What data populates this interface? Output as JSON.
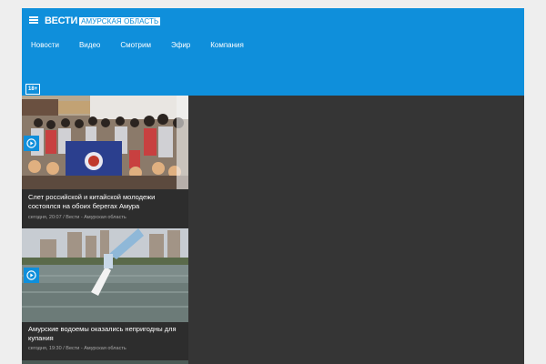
{
  "header": {
    "logo_main": "ВЕСТИ",
    "logo_region": "АМУРСКАЯ ОБЛАСТЬ",
    "menu_icon": "hamburger-menu-icon",
    "nav": [
      {
        "label": "Новости"
      },
      {
        "label": "Видео"
      },
      {
        "label": "Смотрим"
      },
      {
        "label": "Эфир"
      },
      {
        "label": "Компания"
      }
    ],
    "age_rating": "18+"
  },
  "news": [
    {
      "title": "Слет российской и китайской молодежи состоялся на обоих берегах Амура",
      "time": "сегодня, 20:07",
      "source": "Вести - Амурская область",
      "media_icon": "play-video-icon"
    },
    {
      "title": "Амурские водоемы оказались непригодны для купания",
      "time": "сегодня, 19:30",
      "source": "Вести - Амурская область",
      "media_icon": "play-video-icon"
    }
  ],
  "colors": {
    "brand_blue": "#0f8fdb",
    "content_bg": "#353535",
    "card_bg": "#2d2d2d",
    "meta_text": "#a8a8a8"
  }
}
